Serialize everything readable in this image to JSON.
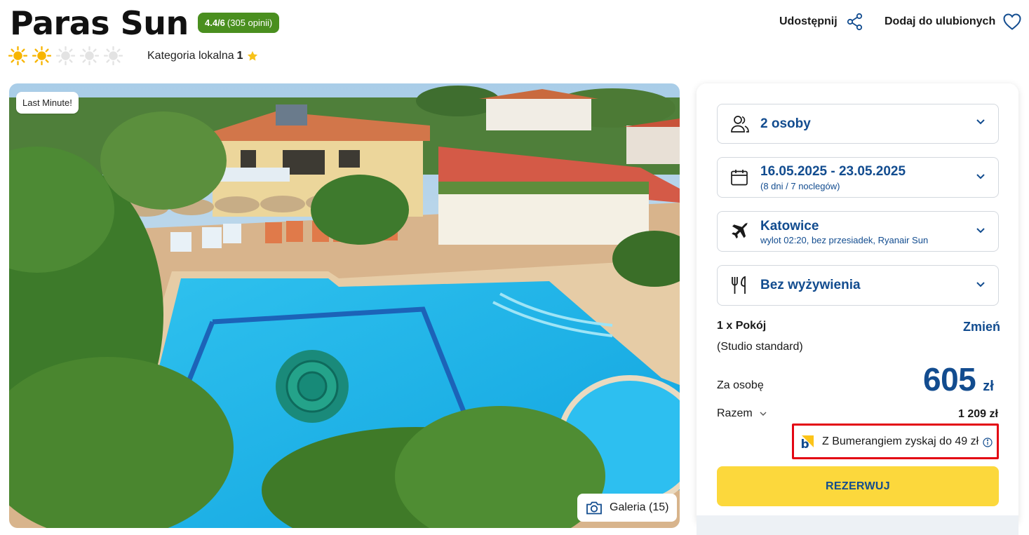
{
  "hotel": {
    "name": "Paras Sun",
    "rating_score": "4.4/6",
    "rating_count": "(305 opinii)",
    "suns_filled": 2,
    "suns_total": 5,
    "category_label": "Kategoria lokalna",
    "category_value": "1"
  },
  "actions": {
    "share_label": "Udostępnij",
    "favorite_label": "Dodaj do ulubionych"
  },
  "photo": {
    "badge": "Last Minute!",
    "gallery_label": "Galeria (15)"
  },
  "booking": {
    "persons": "2 osoby",
    "dates": "16.05.2025 - 23.05.2025",
    "dates_sub": "(8 dni / 7 noclegów)",
    "departure": "Katowice",
    "departure_sub": "wylot 02:20, bez przesiadek, Ryanair Sun",
    "meals": "Bez wyżywienia",
    "room_line1": "1 x Pokój",
    "room_line2": "(Studio standard)",
    "change_label": "Zmień",
    "per_person_label": "Za osobę",
    "price": "605",
    "currency": "zł",
    "total_label": "Razem",
    "total_value": "1 209 zł",
    "promo_text": "Z Bumerangiem zyskaj do 49 zł",
    "reserve_label": "REZERWUJ"
  },
  "colors": {
    "brand_blue": "#124c8f",
    "rating_green": "#4a8f1f",
    "reserve_yellow": "#fcd83c",
    "highlight_red": "#e30613",
    "sun_yellow": "#f7b500"
  }
}
